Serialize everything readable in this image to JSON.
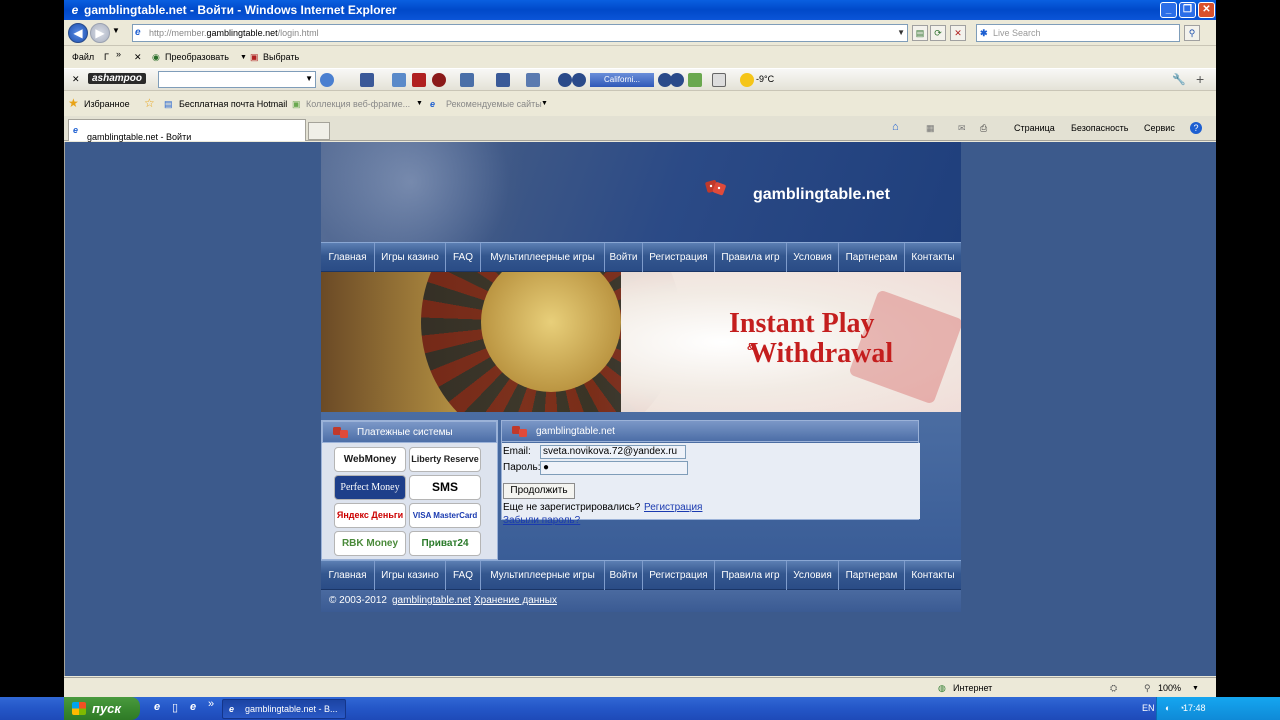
{
  "window": {
    "title": "gamblingtable.net - Войти - Windows Internet Explorer",
    "url_prefix": "http://member.",
    "url_domain": "gamblingtable.net",
    "url_path": "/login.html",
    "search_placeholder": "Live Search"
  },
  "menu": {
    "file": "Файл",
    "g": "Г",
    "chevron": "»",
    "close_x": "✕",
    "convert": "Преобразовать",
    "select": "Выбрать"
  },
  "toolbar": {
    "brand": "ashampoo",
    "calendar": "Californi...",
    "temperature": "-9°C"
  },
  "favorites": {
    "favorites": "Избранное",
    "hotmail": "Бесплатная почта Hotmail",
    "webslice": "Коллекция веб-фрагме...",
    "recommended": "Рекомендуемые сайты"
  },
  "tabs": {
    "active": "gamblingtable.net - Войти",
    "page": "Страница",
    "safety": "Безопасность",
    "service": "Сервис"
  },
  "site": {
    "name": "gamblingtable.net",
    "nav": [
      "Главная",
      "Игры казино",
      "FAQ",
      "Мультиплеерные игры",
      "Войти",
      "Регистрация",
      "Правила игр",
      "Условия",
      "Партнерам",
      "Контакты"
    ],
    "promo_line1": "Instant Play",
    "promo_amp": "&",
    "promo_line2": "Withdrawal",
    "payments_title": "Платежные системы",
    "payments": [
      "WebMoney",
      "Liberty Reserve",
      "Perfect Money",
      "SMS",
      "Яндекс Деньги",
      "VISA MasterCard",
      "RBK Money",
      "Приват24"
    ],
    "login_title": "gamblingtable.net",
    "email_label": "Email:",
    "email_value": "sveta.novikova.72@yandex.ru",
    "password_label": "Пароль:",
    "password_value": "●",
    "submit": "Продолжить",
    "not_registered": "Еще не зарегистрировались?",
    "register_link": "Регистрация",
    "forgot_link": "Забыли пароль?",
    "copyright": "© 2003-2012",
    "copyright_link": "gamblingtable.net",
    "storage_link": "Хранение данных"
  },
  "status": {
    "zone": "Интернет",
    "zoom": "100%"
  },
  "taskbar": {
    "start": "пуск",
    "item": "gamblingtable.net - В...",
    "lang": "EN",
    "time": "17:48"
  },
  "colors": {
    "page_bg": "#3c5a8c",
    "nav_bg": "#34578f",
    "promo_red": "#c41e1e",
    "xp_blue": "#0049c9",
    "start_green": "#3a8a30"
  }
}
